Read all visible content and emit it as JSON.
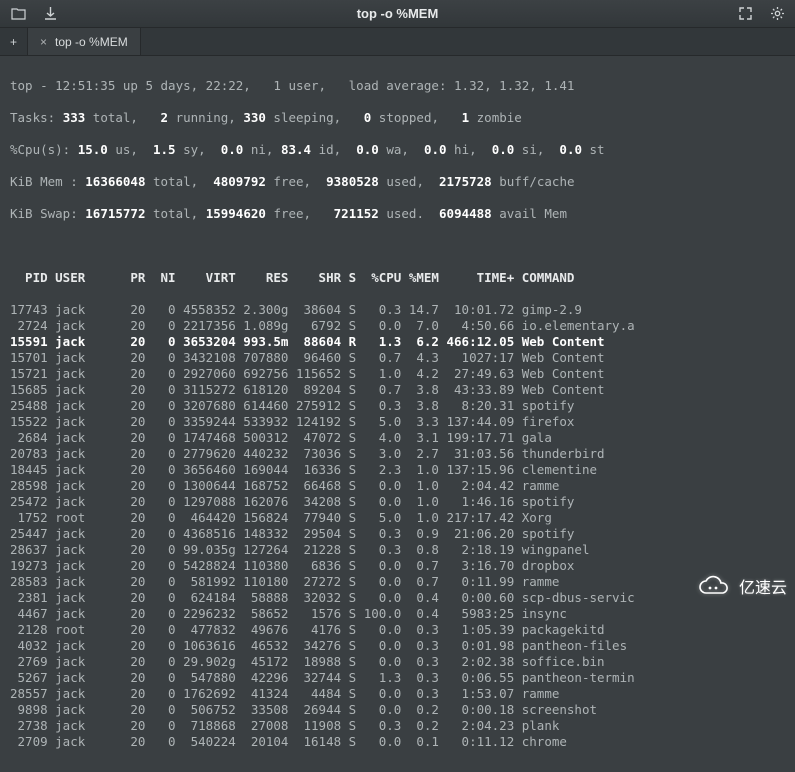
{
  "titlebar": {
    "title": "top -o %MEM"
  },
  "tabs": {
    "add_label": "+",
    "close_label": "×",
    "tab0_label": "top -o %MEM"
  },
  "top": {
    "line1_pre": "top - 12:51:35 up 5 days, 22:22,   1 user,   load average: 1.32, 1.32, 1.41",
    "tasks_label": "Tasks: ",
    "tasks_total": "333",
    "tasks_total_suffix": " total,   ",
    "tasks_running": "2",
    "tasks_running_suffix": " running, ",
    "tasks_sleeping": "330",
    "tasks_sleeping_suffix": " sleeping,   ",
    "tasks_stopped": "0",
    "tasks_stopped_suffix": " stopped,   ",
    "tasks_zombie": "1",
    "tasks_zombie_suffix": " zombie",
    "cpu_label": "%Cpu(s): ",
    "cpu_us": "15.0",
    "cpu_us_suffix": " us,  ",
    "cpu_sy": "1.5",
    "cpu_sy_suffix": " sy,  ",
    "cpu_ni": "0.0",
    "cpu_ni_suffix": " ni, ",
    "cpu_id": "83.4",
    "cpu_id_suffix": " id,  ",
    "cpu_wa": "0.0",
    "cpu_wa_suffix": " wa,  ",
    "cpu_hi": "0.0",
    "cpu_hi_suffix": " hi,  ",
    "cpu_si": "0.0",
    "cpu_si_suffix": " si,  ",
    "cpu_st": "0.0",
    "cpu_st_suffix": " st",
    "mem_label": "KiB Mem : ",
    "mem_total": "16366048",
    "mem_total_suffix": " total,  ",
    "mem_free": "4809792",
    "mem_free_suffix": " free,  ",
    "mem_used": "9380528",
    "mem_used_suffix": " used,  ",
    "mem_cache": "2175728",
    "mem_cache_suffix": " buff/cache",
    "swap_label": "KiB Swap: ",
    "swap_total": "16715772",
    "swap_total_suffix": " total, ",
    "swap_free": "15994620",
    "swap_free_suffix": " free,   ",
    "swap_used": "721152",
    "swap_used_suffix": " used.  ",
    "swap_avail": "6094488",
    "swap_avail_suffix": " avail Mem"
  },
  "columns": "  PID USER      PR  NI    VIRT    RES    SHR S  %CPU %MEM     TIME+ COMMAND",
  "processes": [
    {
      "pid": "17743",
      "user": "jack",
      "pr": "20",
      "ni": "0",
      "virt": "4558352",
      "res": "2.300g",
      "shr": "38604",
      "s": "S",
      "cpu": "0.3",
      "mem": "14.7",
      "time": "10:01.72",
      "cmd": "gimp-2.9",
      "hl": false
    },
    {
      "pid": "2724",
      "user": "jack",
      "pr": "20",
      "ni": "0",
      "virt": "2217356",
      "res": "1.089g",
      "shr": "6792",
      "s": "S",
      "cpu": "0.0",
      "mem": "7.0",
      "time": "4:50.66",
      "cmd": "io.elementary.a",
      "hl": false
    },
    {
      "pid": "15591",
      "user": "jack",
      "pr": "20",
      "ni": "0",
      "virt": "3653204",
      "res": "993.5m",
      "shr": "88604",
      "s": "R",
      "cpu": "1.3",
      "mem": "6.2",
      "time": "466:12.05",
      "cmd": "Web Content",
      "hl": true
    },
    {
      "pid": "15701",
      "user": "jack",
      "pr": "20",
      "ni": "0",
      "virt": "3432108",
      "res": "707880",
      "shr": "96460",
      "s": "S",
      "cpu": "0.7",
      "mem": "4.3",
      "time": "1027:17",
      "cmd": "Web Content",
      "hl": false
    },
    {
      "pid": "15721",
      "user": "jack",
      "pr": "20",
      "ni": "0",
      "virt": "2927060",
      "res": "692756",
      "shr": "115652",
      "s": "S",
      "cpu": "1.0",
      "mem": "4.2",
      "time": "27:49.63",
      "cmd": "Web Content",
      "hl": false
    },
    {
      "pid": "15685",
      "user": "jack",
      "pr": "20",
      "ni": "0",
      "virt": "3115272",
      "res": "618120",
      "shr": "89204",
      "s": "S",
      "cpu": "0.7",
      "mem": "3.8",
      "time": "43:33.89",
      "cmd": "Web Content",
      "hl": false
    },
    {
      "pid": "25488",
      "user": "jack",
      "pr": "20",
      "ni": "0",
      "virt": "3207680",
      "res": "614460",
      "shr": "275912",
      "s": "S",
      "cpu": "0.3",
      "mem": "3.8",
      "time": "8:20.31",
      "cmd": "spotify",
      "hl": false
    },
    {
      "pid": "15522",
      "user": "jack",
      "pr": "20",
      "ni": "0",
      "virt": "3359244",
      "res": "533932",
      "shr": "124192",
      "s": "S",
      "cpu": "5.0",
      "mem": "3.3",
      "time": "137:44.09",
      "cmd": "firefox",
      "hl": false
    },
    {
      "pid": "2684",
      "user": "jack",
      "pr": "20",
      "ni": "0",
      "virt": "1747468",
      "res": "500312",
      "shr": "47072",
      "s": "S",
      "cpu": "4.0",
      "mem": "3.1",
      "time": "199:17.71",
      "cmd": "gala",
      "hl": false
    },
    {
      "pid": "20783",
      "user": "jack",
      "pr": "20",
      "ni": "0",
      "virt": "2779620",
      "res": "440232",
      "shr": "73036",
      "s": "S",
      "cpu": "3.0",
      "mem": "2.7",
      "time": "31:03.56",
      "cmd": "thunderbird",
      "hl": false
    },
    {
      "pid": "18445",
      "user": "jack",
      "pr": "20",
      "ni": "0",
      "virt": "3656460",
      "res": "169044",
      "shr": "16336",
      "s": "S",
      "cpu": "2.3",
      "mem": "1.0",
      "time": "137:15.96",
      "cmd": "clementine",
      "hl": false
    },
    {
      "pid": "28598",
      "user": "jack",
      "pr": "20",
      "ni": "0",
      "virt": "1300644",
      "res": "168752",
      "shr": "66468",
      "s": "S",
      "cpu": "0.0",
      "mem": "1.0",
      "time": "2:04.42",
      "cmd": "ramme",
      "hl": false
    },
    {
      "pid": "25472",
      "user": "jack",
      "pr": "20",
      "ni": "0",
      "virt": "1297088",
      "res": "162076",
      "shr": "34208",
      "s": "S",
      "cpu": "0.0",
      "mem": "1.0",
      "time": "1:46.16",
      "cmd": "spotify",
      "hl": false
    },
    {
      "pid": "1752",
      "user": "root",
      "pr": "20",
      "ni": "0",
      "virt": "464420",
      "res": "156824",
      "shr": "77940",
      "s": "S",
      "cpu": "5.0",
      "mem": "1.0",
      "time": "217:17.42",
      "cmd": "Xorg",
      "hl": false
    },
    {
      "pid": "25447",
      "user": "jack",
      "pr": "20",
      "ni": "0",
      "virt": "4368516",
      "res": "148332",
      "shr": "29504",
      "s": "S",
      "cpu": "0.3",
      "mem": "0.9",
      "time": "21:06.20",
      "cmd": "spotify",
      "hl": false
    },
    {
      "pid": "28637",
      "user": "jack",
      "pr": "20",
      "ni": "0",
      "virt": "99.035g",
      "res": "127264",
      "shr": "21228",
      "s": "S",
      "cpu": "0.3",
      "mem": "0.8",
      "time": "2:18.19",
      "cmd": "wingpanel",
      "hl": false
    },
    {
      "pid": "19273",
      "user": "jack",
      "pr": "20",
      "ni": "0",
      "virt": "5428824",
      "res": "110380",
      "shr": "6836",
      "s": "S",
      "cpu": "0.0",
      "mem": "0.7",
      "time": "3:16.70",
      "cmd": "dropbox",
      "hl": false
    },
    {
      "pid": "28583",
      "user": "jack",
      "pr": "20",
      "ni": "0",
      "virt": "581992",
      "res": "110180",
      "shr": "27272",
      "s": "S",
      "cpu": "0.0",
      "mem": "0.7",
      "time": "0:11.99",
      "cmd": "ramme",
      "hl": false
    },
    {
      "pid": "2381",
      "user": "jack",
      "pr": "20",
      "ni": "0",
      "virt": "624184",
      "res": "58888",
      "shr": "32032",
      "s": "S",
      "cpu": "0.0",
      "mem": "0.4",
      "time": "0:00.60",
      "cmd": "scp-dbus-servic",
      "hl": false
    },
    {
      "pid": "4467",
      "user": "jack",
      "pr": "20",
      "ni": "0",
      "virt": "2296232",
      "res": "58652",
      "shr": "1576",
      "s": "S",
      "cpu": "100.0",
      "mem": "0.4",
      "time": "5983:25",
      "cmd": "insync",
      "hl": false
    },
    {
      "pid": "2128",
      "user": "root",
      "pr": "20",
      "ni": "0",
      "virt": "477832",
      "res": "49676",
      "shr": "4176",
      "s": "S",
      "cpu": "0.0",
      "mem": "0.3",
      "time": "1:05.39",
      "cmd": "packagekitd",
      "hl": false
    },
    {
      "pid": "4032",
      "user": "jack",
      "pr": "20",
      "ni": "0",
      "virt": "1063616",
      "res": "46532",
      "shr": "34276",
      "s": "S",
      "cpu": "0.0",
      "mem": "0.3",
      "time": "0:01.98",
      "cmd": "pantheon-files",
      "hl": false
    },
    {
      "pid": "2769",
      "user": "jack",
      "pr": "20",
      "ni": "0",
      "virt": "29.902g",
      "res": "45172",
      "shr": "18988",
      "s": "S",
      "cpu": "0.0",
      "mem": "0.3",
      "time": "2:02.38",
      "cmd": "soffice.bin",
      "hl": false
    },
    {
      "pid": "5267",
      "user": "jack",
      "pr": "20",
      "ni": "0",
      "virt": "547880",
      "res": "42296",
      "shr": "32744",
      "s": "S",
      "cpu": "1.3",
      "mem": "0.3",
      "time": "0:06.55",
      "cmd": "pantheon-termin",
      "hl": false
    },
    {
      "pid": "28557",
      "user": "jack",
      "pr": "20",
      "ni": "0",
      "virt": "1762692",
      "res": "41324",
      "shr": "4484",
      "s": "S",
      "cpu": "0.0",
      "mem": "0.3",
      "time": "1:53.07",
      "cmd": "ramme",
      "hl": false
    },
    {
      "pid": "9898",
      "user": "jack",
      "pr": "20",
      "ni": "0",
      "virt": "506752",
      "res": "33508",
      "shr": "26944",
      "s": "S",
      "cpu": "0.0",
      "mem": "0.2",
      "time": "0:00.18",
      "cmd": "screenshot",
      "hl": false
    },
    {
      "pid": "2738",
      "user": "jack",
      "pr": "20",
      "ni": "0",
      "virt": "718868",
      "res": "27008",
      "shr": "11908",
      "s": "S",
      "cpu": "0.3",
      "mem": "0.2",
      "time": "2:04.23",
      "cmd": "plank",
      "hl": false
    },
    {
      "pid": "2709",
      "user": "jack",
      "pr": "20",
      "ni": "0",
      "virt": "540224",
      "res": "20104",
      "shr": "16148",
      "s": "S",
      "cpu": "0.0",
      "mem": "0.1",
      "time": "0:11.12",
      "cmd": "chrome",
      "hl": false
    }
  ],
  "watermark": "亿速云"
}
